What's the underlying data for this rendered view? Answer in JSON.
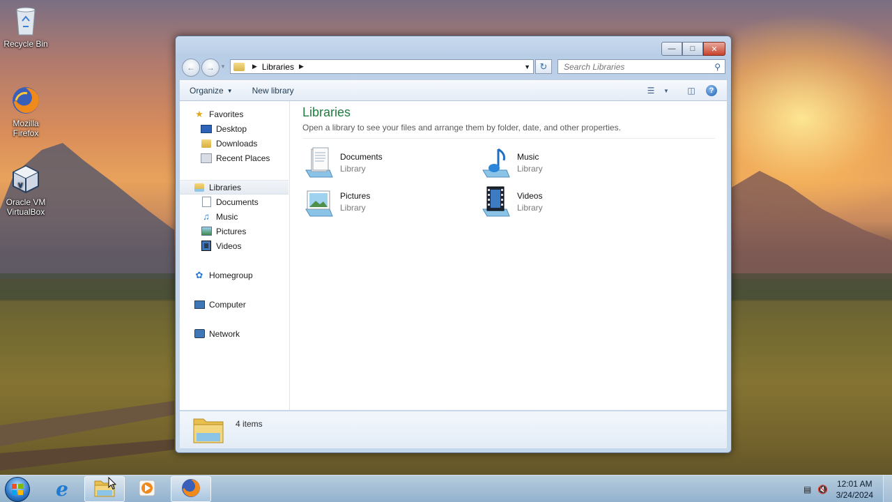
{
  "desktop": {
    "icons": [
      {
        "label_line1": "Recycle Bin",
        "label_line2": ""
      },
      {
        "label_line1": "Mozilla",
        "label_line2": "Firefox"
      },
      {
        "label_line1": "Oracle VM",
        "label_line2": "VirtualBox"
      }
    ]
  },
  "window": {
    "address": {
      "crumbs": [
        "Libraries"
      ]
    },
    "search": {
      "placeholder": "Search Libraries"
    },
    "toolbar": {
      "organize": "Organize",
      "new_library": "New library"
    },
    "nav": {
      "favorites": "Favorites",
      "favorites_items": [
        "Desktop",
        "Downloads",
        "Recent Places"
      ],
      "libraries": "Libraries",
      "libraries_items": [
        "Documents",
        "Music",
        "Pictures",
        "Videos"
      ],
      "homegroup": "Homegroup",
      "computer": "Computer",
      "network": "Network"
    },
    "main": {
      "title": "Libraries",
      "description": "Open a library to see your files and arrange them by folder, date, and other properties.",
      "libraries": [
        {
          "name": "Documents",
          "type": "Library"
        },
        {
          "name": "Music",
          "type": "Library"
        },
        {
          "name": "Pictures",
          "type": "Library"
        },
        {
          "name": "Videos",
          "type": "Library"
        }
      ]
    },
    "details": {
      "count": "4 items"
    }
  },
  "taskbar": {
    "clock": {
      "time": "12:01 AM",
      "date": "3/24/2024"
    }
  },
  "colors": {
    "title_green": "#1e7d3e",
    "taskbar": "#a9c8e6",
    "close_red": "#c7432d"
  }
}
